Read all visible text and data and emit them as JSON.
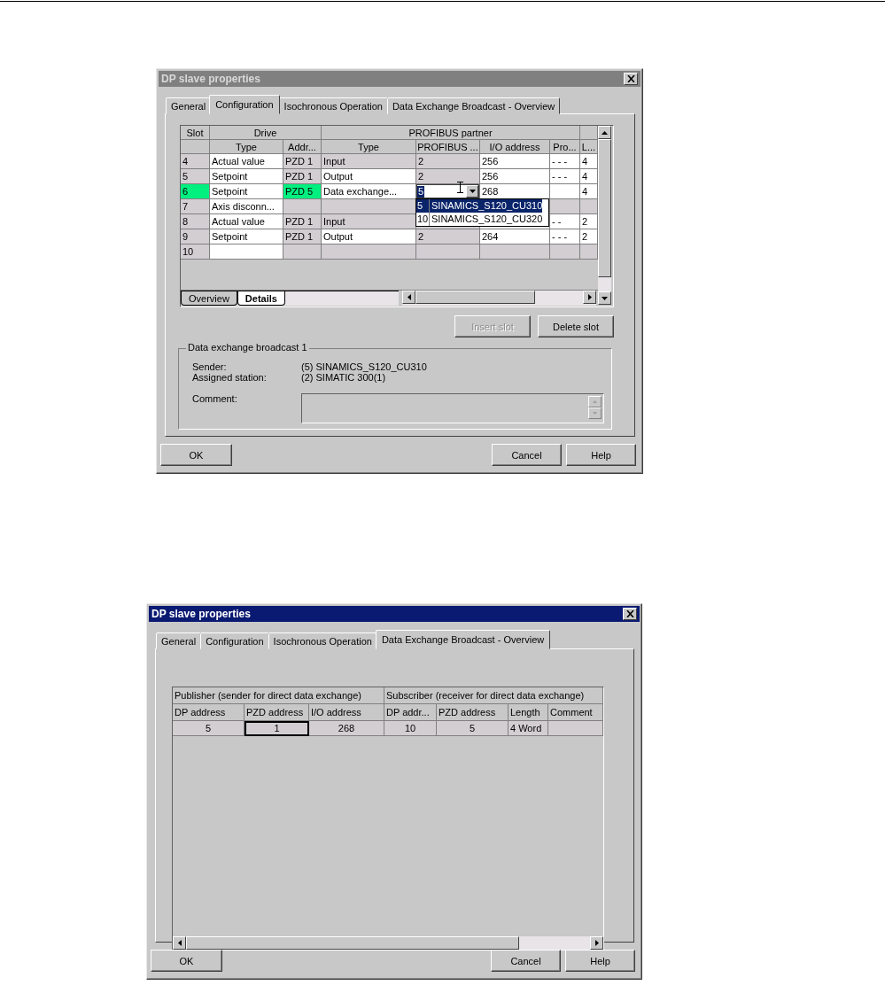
{
  "config_dialog": {
    "title": "DP slave properties",
    "active": false,
    "tabs": [
      {
        "label": "General",
        "selected": false
      },
      {
        "label": "Configuration",
        "selected": true
      },
      {
        "label": "Isochronous Operation",
        "selected": false
      },
      {
        "label": "Data Exchange Broadcast - Overview",
        "selected": false
      }
    ],
    "table": {
      "header_groups": [
        {
          "label": "Slot"
        },
        {
          "label": "Drive"
        },
        {
          "label": "PROFIBUS partner"
        }
      ],
      "columns": [
        "",
        "Type",
        "Addr...",
        "Type",
        "PROFIBUS ...",
        "I/O address",
        "Pro...",
        "L..."
      ],
      "rows": [
        {
          "cells": [
            {
              "text": "4",
              "kind": "fixed"
            },
            {
              "text": "Actual value",
              "kind": "edit"
            },
            {
              "text": "PZD 1",
              "kind": "fixed"
            },
            {
              "text": "Input",
              "kind": "fixed"
            },
            {
              "text": "2",
              "kind": "fixed"
            },
            {
              "text": "256",
              "kind": "edit"
            },
            {
              "text": "- - -",
              "kind": "edit"
            },
            {
              "text": "4",
              "kind": "edit"
            }
          ]
        },
        {
          "cells": [
            {
              "text": "5",
              "kind": "fixed"
            },
            {
              "text": "Setpoint",
              "kind": "edit"
            },
            {
              "text": "PZD 1",
              "kind": "fixed"
            },
            {
              "text": "Output",
              "kind": "edit"
            },
            {
              "text": "2",
              "kind": "fixed"
            },
            {
              "text": "256",
              "kind": "edit"
            },
            {
              "text": "- - -",
              "kind": "edit"
            },
            {
              "text": "4",
              "kind": "edit"
            }
          ]
        },
        {
          "cells": [
            {
              "text": "6",
              "kind": "highlight"
            },
            {
              "text": "Setpoint",
              "kind": "edit"
            },
            {
              "text": "PZD 5",
              "kind": "highlight"
            },
            {
              "text": "Data exchange...",
              "kind": "edit"
            },
            {
              "text": "5",
              "kind": "combo"
            },
            {
              "text": "268",
              "kind": "edit"
            },
            {
              "kind": "edit"
            },
            {
              "text": "4",
              "kind": "edit"
            }
          ]
        },
        {
          "cells": [
            {
              "text": "7",
              "kind": "fixed"
            },
            {
              "text": "Axis disconn...",
              "kind": "edit"
            },
            {
              "kind": "fixed"
            },
            {
              "kind": "fixed"
            },
            {
              "kind": "fixed"
            },
            {
              "kind": "fixed"
            },
            {
              "kind": "fixed"
            },
            {
              "kind": "fixed"
            }
          ]
        },
        {
          "cells": [
            {
              "text": "8",
              "kind": "fixed"
            },
            {
              "text": "Actual value",
              "kind": "edit"
            },
            {
              "text": "PZD 1",
              "kind": "fixed"
            },
            {
              "text": "Input",
              "kind": "fixed"
            },
            {
              "kind": "fixed"
            },
            {
              "kind": "edit"
            },
            {
              "text": "- -",
              "kind": "edit"
            },
            {
              "text": "2",
              "kind": "edit"
            }
          ]
        },
        {
          "cells": [
            {
              "text": "9",
              "kind": "fixed"
            },
            {
              "text": "Setpoint",
              "kind": "edit"
            },
            {
              "text": "PZD 1",
              "kind": "fixed"
            },
            {
              "text": "Output",
              "kind": "edit"
            },
            {
              "text": "2",
              "kind": "fixed"
            },
            {
              "text": "264",
              "kind": "edit"
            },
            {
              "text": "- - -",
              "kind": "edit"
            },
            {
              "text": "2",
              "kind": "edit"
            }
          ]
        },
        {
          "cells": [
            {
              "text": "10",
              "kind": "fixed"
            },
            {
              "kind": "edit"
            },
            {
              "kind": "fixed"
            },
            {
              "kind": "fixed"
            },
            {
              "kind": "fixed"
            },
            {
              "kind": "fixed"
            },
            {
              "kind": "fixed"
            },
            {
              "kind": "fixed"
            }
          ]
        }
      ]
    },
    "dropdown": [
      {
        "number": "5",
        "name": "SINAMICS_S120_CU310",
        "selected": true
      },
      {
        "number": "10",
        "name": "SINAMICS_S120_CU320",
        "selected": false
      }
    ],
    "sheet_tabs": [
      {
        "label": "Overview",
        "selected": false
      },
      {
        "label": "Details",
        "selected": true
      }
    ],
    "slot_buttons": [
      {
        "label": "Insert slot",
        "disabled": true
      },
      {
        "label": "Delete slot",
        "disabled": false
      }
    ],
    "group": {
      "title": "Data exchange broadcast 1",
      "fields": [
        {
          "label": "Sender:",
          "value": "(5) SINAMICS_S120_CU310"
        },
        {
          "label": "Assigned station:",
          "value": "(2) SIMATIC 300(1)"
        }
      ],
      "comment_label": "Comment:"
    },
    "footer_left": "OK",
    "footer_right": [
      "Cancel",
      "Help"
    ]
  },
  "overview_dialog": {
    "title": "DP slave properties",
    "active": true,
    "tabs": [
      {
        "label": "General",
        "selected": false
      },
      {
        "label": "Configuration",
        "selected": false
      },
      {
        "label": "Isochronous Operation",
        "selected": false
      },
      {
        "label": "Data Exchange Broadcast - Overview",
        "selected": true
      }
    ],
    "table": {
      "header_groups": [
        {
          "label": "Publisher (sender for direct data exchange)"
        },
        {
          "label": "Subscriber (receiver for direct data exchange)"
        }
      ],
      "columns": [
        "DP address",
        "PZD address",
        "I/O address",
        "DP addr...",
        "PZD address",
        "Length",
        "Comment"
      ],
      "rows": [
        {
          "cells": [
            {
              "text": "5",
              "kind": "number"
            },
            {
              "text": "1",
              "kind": "focused"
            },
            {
              "text": "268",
              "kind": "number"
            },
            {
              "text": "10",
              "kind": "number"
            },
            {
              "text": "5",
              "kind": "number"
            },
            {
              "text": "4 Word",
              "kind": "text"
            },
            {
              "kind": "text"
            }
          ]
        }
      ]
    },
    "footer_left": "OK",
    "footer_right": [
      "Cancel",
      "Help"
    ]
  }
}
